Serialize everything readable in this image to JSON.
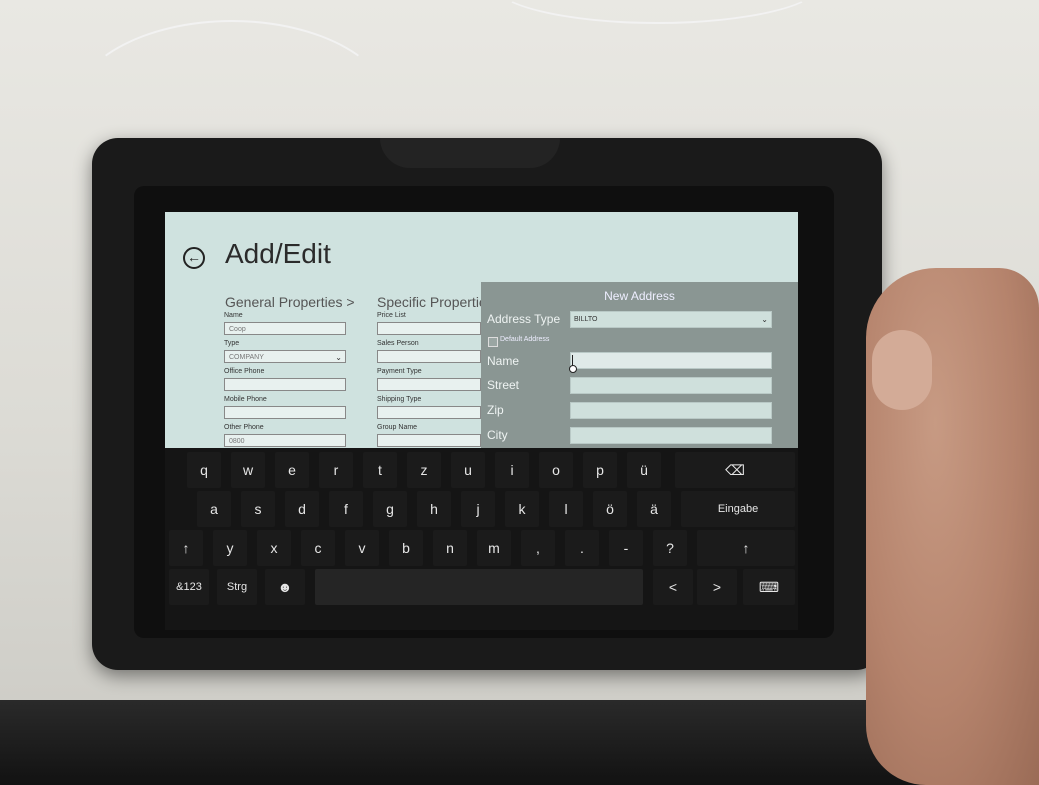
{
  "page": {
    "title": "Add/Edit"
  },
  "sections": {
    "general": "General Properties  >",
    "specific": "Specific Properties"
  },
  "general_fields": [
    {
      "label": "Name",
      "value": "Coop"
    },
    {
      "label": "Type",
      "value": "COMPANY"
    },
    {
      "label": "Office Phone",
      "value": ""
    },
    {
      "label": "Mobile Phone",
      "value": ""
    },
    {
      "label": "Other Phone",
      "value": "0800"
    }
  ],
  "specific_fields": [
    {
      "label": "Price List",
      "value": ""
    },
    {
      "label": "Sales Person",
      "value": ""
    },
    {
      "label": "Payment Type",
      "value": ""
    },
    {
      "label": "Shipping Type",
      "value": ""
    },
    {
      "label": "Group Name",
      "value": ""
    }
  ],
  "dialog": {
    "title": "New Address",
    "address_type_label": "Address Type",
    "address_type_value": "BILLTO",
    "default_address_label": "Default Address",
    "name_label": "Name",
    "street_label": "Street",
    "zip_label": "Zip",
    "city_label": "City"
  },
  "keyboard": {
    "row1": [
      "q",
      "w",
      "e",
      "r",
      "t",
      "z",
      "u",
      "i",
      "o",
      "p",
      "ü"
    ],
    "row2": [
      "a",
      "s",
      "d",
      "f",
      "g",
      "h",
      "j",
      "k",
      "l",
      "ö",
      "ä"
    ],
    "row3": [
      "↑",
      "y",
      "x",
      "c",
      "v",
      "b",
      "n",
      "m",
      ",",
      ".",
      "-",
      "?",
      "↑"
    ],
    "enter": "Eingabe",
    "mode": "&123",
    "ctrl": "Strg",
    "emoji": "☻",
    "left": "<",
    "right": ">",
    "backspace": "⌫",
    "keyboard_icon": "⌨"
  }
}
